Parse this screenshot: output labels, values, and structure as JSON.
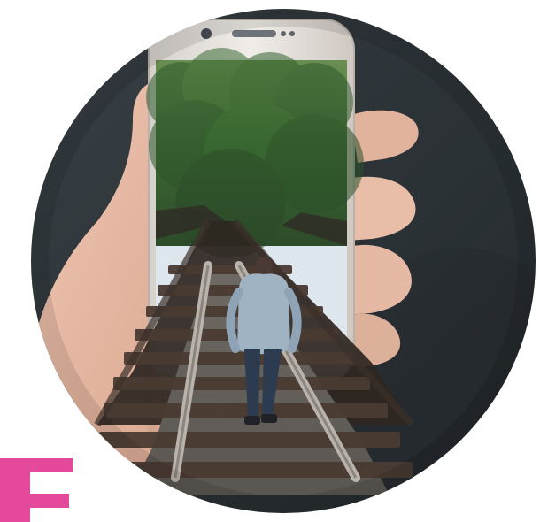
{
  "image": {
    "kind": "photo-composite",
    "subject": "phone-with-railway-coming-out",
    "colors": {
      "background_circle": "#2f3438",
      "phone_body": "#e9e6e2",
      "phone_bezel": "#d7d2cc",
      "phone_screen_top": "#dfe7ee",
      "forest_dark": "#2d4b2a",
      "forest_mid": "#3d6a33",
      "forest_light": "#6b8f52",
      "rail_steel": "#a8a29b",
      "wood_dark": "#3a2f28",
      "wood_mid": "#5b4a3e",
      "gravel": "#6f6a64",
      "shirt": "#9fb3c3",
      "jeans": "#2c3b4f",
      "skin": "#e7b9a3",
      "accent_logo": "#e5499c"
    },
    "icons": [
      "phone-camera-icon",
      "phone-speaker-icon",
      "phone-sensors-icon"
    ]
  }
}
